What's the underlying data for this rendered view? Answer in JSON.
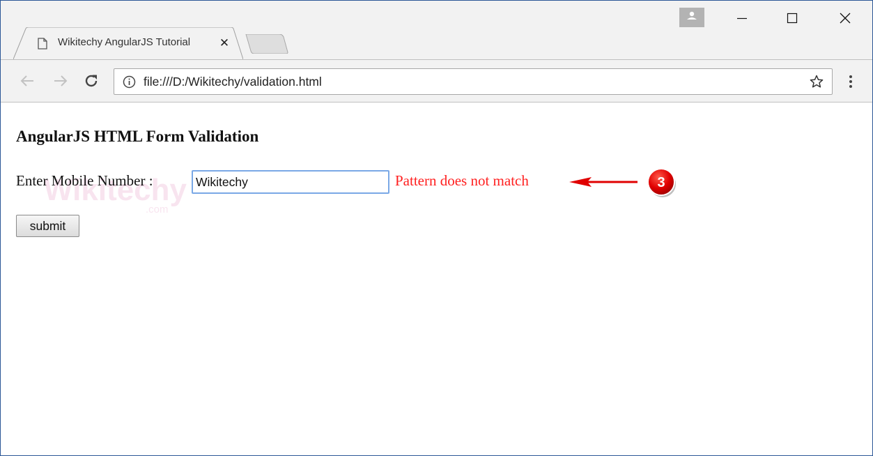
{
  "browser": {
    "tab": {
      "title": "Wikitechy AngularJS Tutorial"
    },
    "address_bar": {
      "url": "file:///D:/Wikitechy/validation.html"
    }
  },
  "page": {
    "heading": "AngularJS HTML Form Validation",
    "form": {
      "mobile_label": "Enter Mobile Number :",
      "mobile_value": "Wikitechy",
      "error_message": "Pattern does not match",
      "submit_label": "submit"
    },
    "annotation": {
      "step_number": "3",
      "color": "#e00000"
    },
    "watermark": {
      "text": "Wikitechy",
      "suffix": ".com"
    }
  },
  "colors": {
    "window_border": "#2b5797",
    "chrome_bg": "#f2f2f2",
    "error": "#ff2020",
    "input_focus": "#7aa8e6"
  },
  "icons": [
    "page-icon",
    "close-icon",
    "new-tab-icon",
    "profile-icon",
    "minimize-icon",
    "maximize-icon",
    "window-close-icon",
    "back-arrow-icon",
    "forward-arrow-icon",
    "reload-icon",
    "info-icon",
    "star-icon",
    "menu-icon",
    "arrow-icon"
  ]
}
